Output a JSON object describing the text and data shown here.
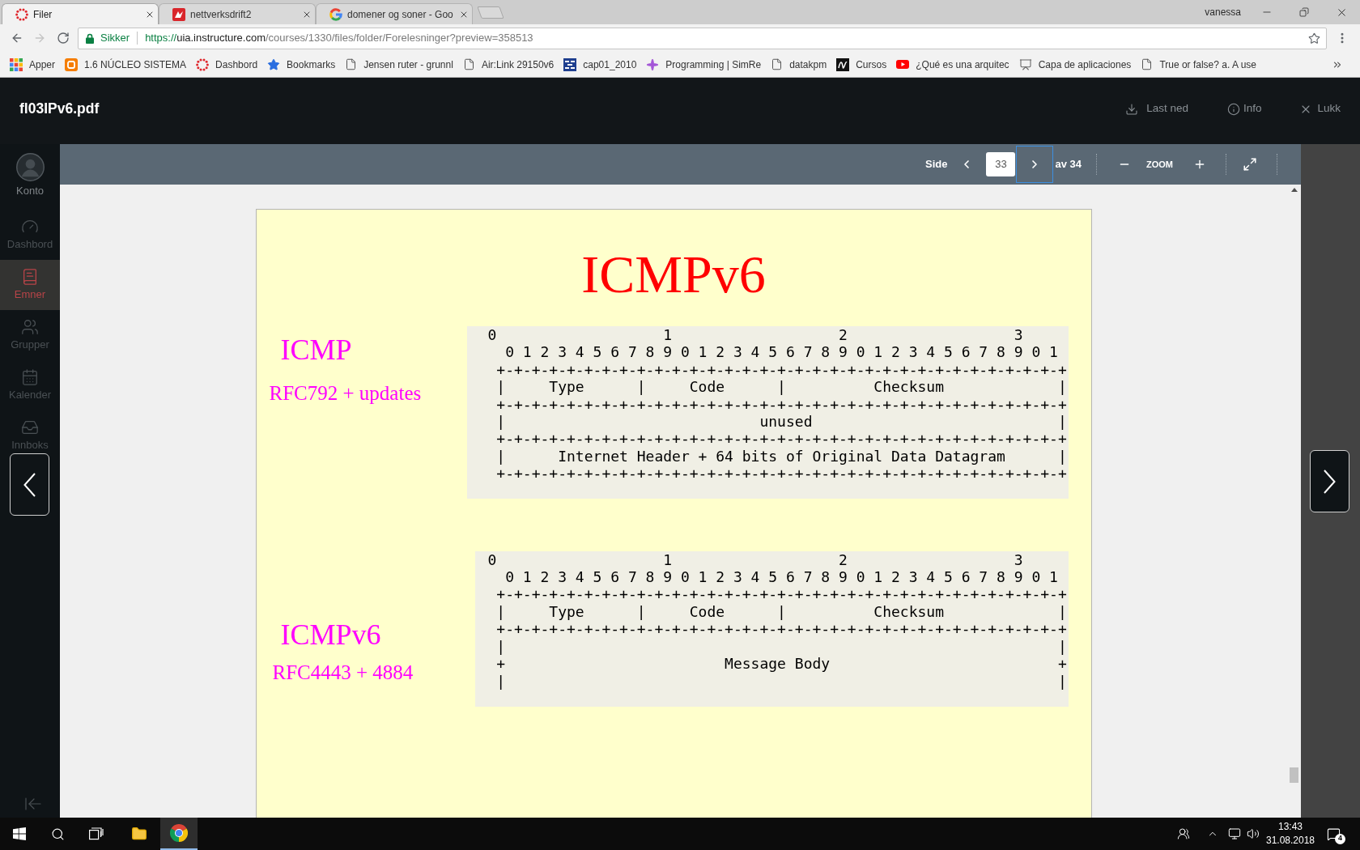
{
  "browser": {
    "tabs": [
      {
        "title": "Filer",
        "selected": true
      },
      {
        "title": "nettverksdrift2",
        "selected": false
      },
      {
        "title": "domener og soner - Goo",
        "selected": false
      }
    ],
    "profile": "vanessa",
    "address_bar": {
      "security_label": "Sikker",
      "url_scheme": "https://",
      "url_host": "uia.instructure.com",
      "url_path": "/courses/1330/files/folder/Forelesninger?preview=358513"
    },
    "bookmarks": [
      "Apper",
      "1.6 NÚCLEO SISTEMA",
      "Dashbord",
      "Bookmarks",
      "Jensen ruter - grunnl",
      "Air:Link 29150v6",
      "cap01_2010",
      "Programming | SimRe",
      "datakpm",
      "Cursos",
      "¿Qué es una arquitec",
      "Capa de aplicaciones",
      "True or false? a. A use"
    ]
  },
  "sidebar": {
    "items": [
      {
        "kind": "account",
        "label": "Konto",
        "selected": false
      },
      {
        "kind": "link",
        "label": "Dashbord",
        "selected": false
      },
      {
        "kind": "link",
        "label": "Emner",
        "selected": true
      },
      {
        "kind": "link",
        "label": "Grupper",
        "selected": false
      },
      {
        "kind": "link",
        "label": "Kalender",
        "selected": false
      },
      {
        "kind": "link",
        "label": "Innboks",
        "selected": false
      }
    ]
  },
  "viewer": {
    "file_name": "fl03IPv6.pdf",
    "actions": [
      "Last ned",
      "Info",
      "Lukk"
    ],
    "toolbar": {
      "page_label": "Side",
      "page_value": "33",
      "page_count": "av 34",
      "next_focused": true,
      "zoom_label": "ZOOM"
    }
  },
  "page": {
    "title": "ICMPv6",
    "sections": [
      {
        "label": "ICMP",
        "reference": "RFC792 + updates",
        "diagram": [
          "0                   1                   2                   3",
          "  0 1 2 3 4 5 6 7 8 9 0 1 2 3 4 5 6 7 8 9 0 1 2 3 4 5 6 7 8 9 0 1",
          " +-+-+-+-+-+-+-+-+-+-+-+-+-+-+-+-+-+-+-+-+-+-+-+-+-+-+-+-+-+-+-+-+",
          " |     Type      |     Code      |          Checksum             |",
          " +-+-+-+-+-+-+-+-+-+-+-+-+-+-+-+-+-+-+-+-+-+-+-+-+-+-+-+-+-+-+-+-+",
          " |                             unused                            |",
          " +-+-+-+-+-+-+-+-+-+-+-+-+-+-+-+-+-+-+-+-+-+-+-+-+-+-+-+-+-+-+-+-+",
          " |      Internet Header + 64 bits of Original Data Datagram      |",
          " +-+-+-+-+-+-+-+-+-+-+-+-+-+-+-+-+-+-+-+-+-+-+-+-+-+-+-+-+-+-+-+-+"
        ]
      },
      {
        "label": "ICMPv6",
        "reference": "RFC4443 + 4884",
        "diagram": [
          "0                   1                   2                   3",
          "  0 1 2 3 4 5 6 7 8 9 0 1 2 3 4 5 6 7 8 9 0 1 2 3 4 5 6 7 8 9 0 1",
          " +-+-+-+-+-+-+-+-+-+-+-+-+-+-+-+-+-+-+-+-+-+-+-+-+-+-+-+-+-+-+-+-+",
          " |     Type      |     Code      |          Checksum             |",
          " +-+-+-+-+-+-+-+-+-+-+-+-+-+-+-+-+-+-+-+-+-+-+-+-+-+-+-+-+-+-+-+-+",
          " |                                                               |",
          " +                         Message Body                          +",
          " |                                                               |"
        ]
      }
    ]
  },
  "taskbar": {
    "apps": [
      {
        "active": false
      },
      {
        "active": true
      }
    ],
    "time": "13:43",
    "date": "31.08.2018",
    "notification_count": "4"
  }
}
